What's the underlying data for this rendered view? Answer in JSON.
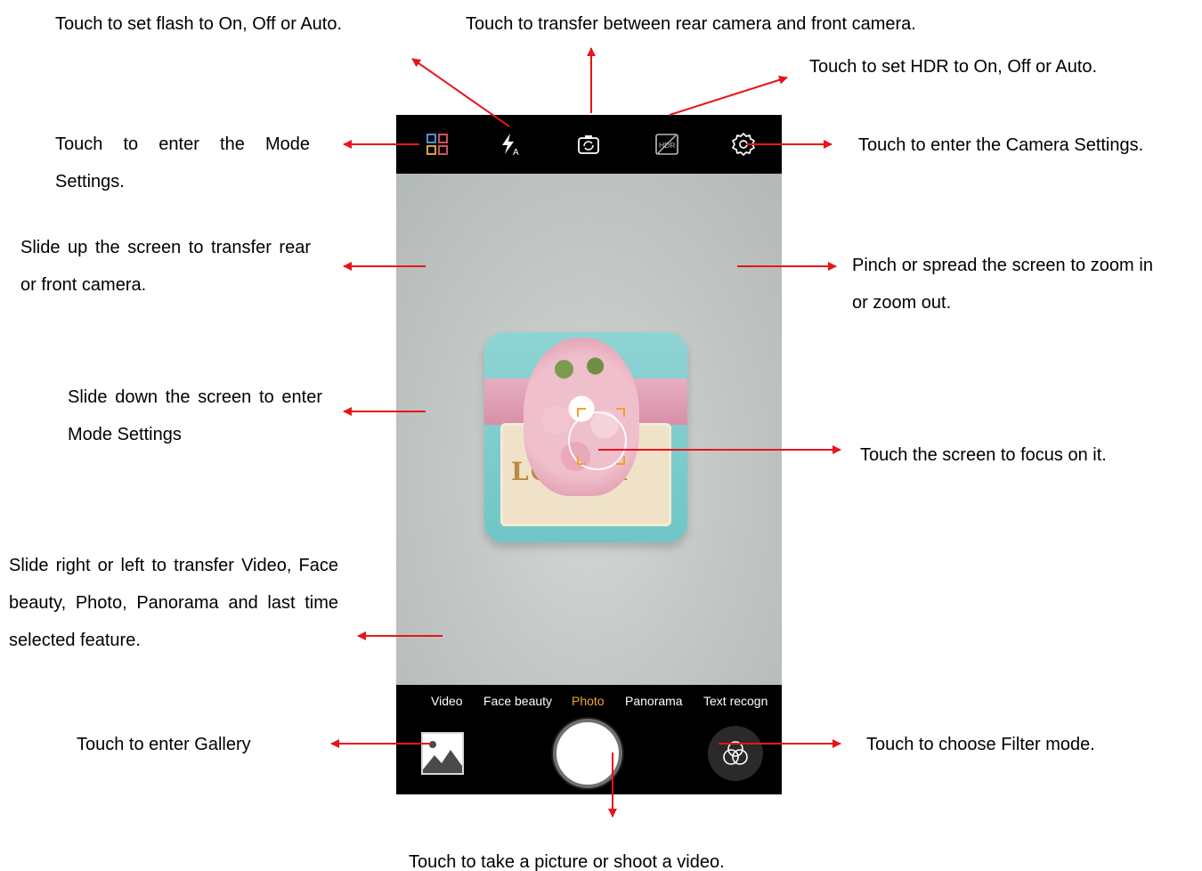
{
  "annotations": {
    "flash": "Touch to set flash to On, Off or Auto.",
    "switch_camera": "Touch to transfer between rear camera and front camera.",
    "hdr": "Touch to set HDR to On, Off or Auto.",
    "mode_settings": "Touch to enter the Mode Settings.",
    "camera_settings": "Touch to enter the Camera Settings.",
    "slide_up": "Slide up the screen to transfer rear or front camera.",
    "pinch": "Pinch or spread the screen to zoom in or zoom out.",
    "slide_down": "Slide down the screen to enter Mode Settings",
    "focus": "Touch the screen to focus on it.",
    "slide_sideways": "Slide right or left to transfer Video, Face beauty, Photo, Panorama and last time selected feature.",
    "gallery": "Touch to enter Gallery",
    "filter": "Touch to choose Filter mode.",
    "shutter": "Touch to take a picture or shoot a video."
  },
  "camera": {
    "top_icons": [
      "mode-grid-icon",
      "flash-auto-icon",
      "switch-camera-icon",
      "hdr-icon",
      "gear-icon"
    ],
    "hdr_label": "HDR",
    "card_text": "LO    VER",
    "modes": [
      {
        "label": "Video",
        "active": false
      },
      {
        "label": "Face beauty",
        "active": false
      },
      {
        "label": "Photo",
        "active": true
      },
      {
        "label": "Panorama",
        "active": false
      },
      {
        "label": "Text recogn",
        "active": false
      }
    ],
    "bottom_icons": [
      "gallery-thumbnail-icon",
      "shutter-button",
      "filter-icon"
    ]
  },
  "colors": {
    "annotation_arrow": "#e8141b",
    "active_mode": "#f0a530",
    "camera_bars": "#000000",
    "focus_frame": "#f2a12a"
  }
}
